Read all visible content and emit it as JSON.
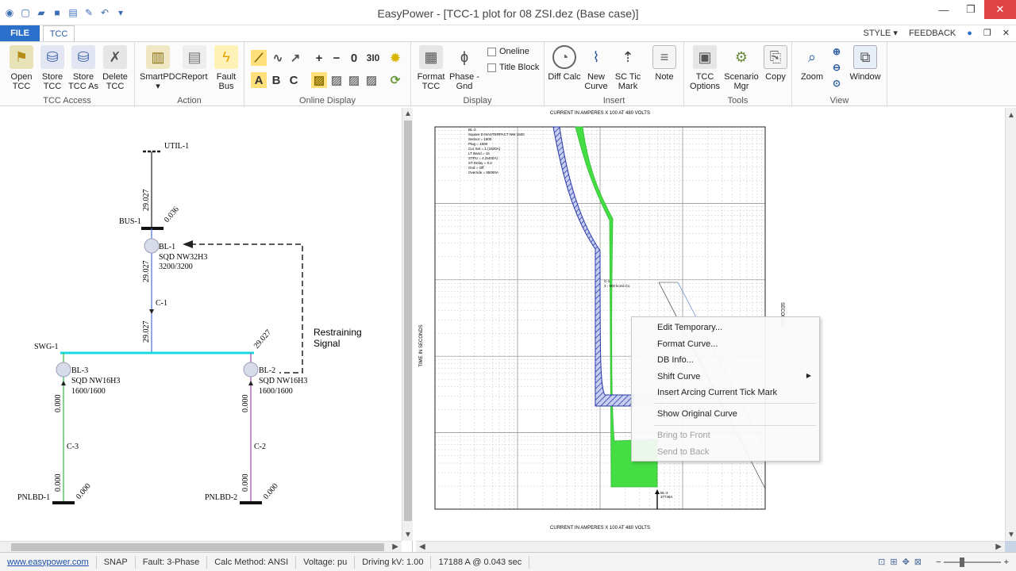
{
  "window": {
    "title": "EasyPower - [TCC-1 plot for 08 ZSI.dez  (Base case)]"
  },
  "tabs": {
    "file": "FILE",
    "tcc": "TCC",
    "style": "STYLE",
    "feedback": "FEEDBACK"
  },
  "ribbon": {
    "tcc_access": {
      "label": "TCC Access",
      "open": "Open TCC",
      "store": "Store TCC",
      "store_as": "Store TCC As",
      "delete": "Delete TCC"
    },
    "action": {
      "label": "Action",
      "smartpdc": "SmartPDC",
      "report": "Report",
      "fault_bus": "Fault Bus"
    },
    "online_display": {
      "label": "Online Display",
      "a": "A",
      "b": "B",
      "c": "C",
      "zero": "0",
      "three": "3I0"
    },
    "display": {
      "label": "Display",
      "format_tcc": "Format TCC",
      "phase_gnd": "Phase - Gnd",
      "oneline": "Oneline",
      "title_block": "Title Block"
    },
    "insert": {
      "label": "Insert",
      "diff_calc": "Diff Calc",
      "new_curve": "New Curve",
      "sc_tic_mark": "SC Tic Mark",
      "note": "Note"
    },
    "tools": {
      "label": "Tools",
      "tcc_options": "TCC Options",
      "scenario_mgr": "Scenario Mgr",
      "copy": "Copy"
    },
    "view": {
      "label": "View",
      "zoom": "Zoom",
      "window": "Window"
    }
  },
  "oneline": {
    "util": "UTIL-1",
    "bus1": "BUS-1",
    "bl1": "BL-1",
    "bl1_model": "SQD NW32H3",
    "bl1_rating": "3200/3200",
    "c1": "C-1",
    "swg1": "SWG-1",
    "bl3": "BL-3",
    "bl3_model": "SQD NW16H3",
    "bl3_rating": "1600/1600",
    "bl2": "BL-2",
    "bl2_model": "SQD NW16H3",
    "bl2_rating": "1600/1600",
    "c3": "C-3",
    "c2": "C-2",
    "pnlbd1": "PNLBD-1",
    "pnlbd2": "PNLBD-2",
    "restraining_1": "Restraining",
    "restraining_2": "Signal",
    "val_29027": "29.027",
    "val_0036": "0.036",
    "val_0000": "0.000"
  },
  "tcc": {
    "top_axis": "CURRENT IN AMPERES X 100 AT 480 VOLTS",
    "bottom_axis": "CURRENT IN AMPERES X 100 AT 480 VOLTS",
    "left_axis": "TIME IN SECONDS",
    "right_axis": "SECONDS",
    "legend_lines": [
      "BL-3",
      "Square D MASTERPACT NW 1600",
      "Sensor = 1600",
      "Plug = 1600",
      "Cur Set = 1 (1600A)",
      "LT Band = 16",
      "STPU = 4 (6400A)",
      "ST Delay = 0.2",
      "Gnd = Off",
      "Override = 85000A"
    ],
    "c1_label": "C-1",
    "c1_sub": "3 - 500 kcmil Cu",
    "bl3_mark": "BL-3",
    "bl3_mark_val": "37746A"
  },
  "context_menu": {
    "items": [
      "Edit Temporary...",
      "Format Curve...",
      "DB Info...",
      "Shift Curve",
      "Insert Arcing Current Tick Mark",
      "Show Original Curve",
      "Bring to Front",
      "Send to Back"
    ]
  },
  "status": {
    "website": "www.easypower.com",
    "snap": "SNAP",
    "fault": "Fault: 3-Phase",
    "calc": "Calc Method: ANSI",
    "voltage": "Voltage: pu",
    "driving": "Driving kV: 1.00",
    "readout": "17188 A @ 0.043 sec"
  },
  "colors": {
    "accent": "#2a6fc9",
    "breaker_curve": "#3344aa",
    "fuse_curve": "#44dd44",
    "swg_bus": "#18d8e0",
    "restraint": "#222222"
  }
}
